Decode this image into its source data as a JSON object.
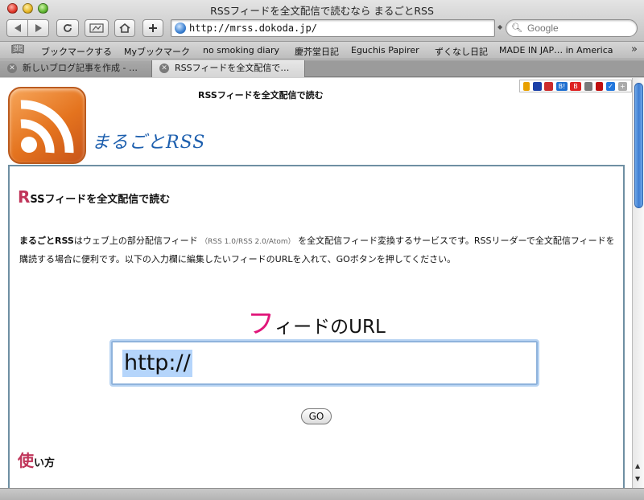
{
  "window": {
    "title": "RSSフィードを全文配信で読むなら まるごとRSS"
  },
  "toolbar": {
    "url": "http://mrss.dokoda.jp/",
    "search_placeholder": "Google"
  },
  "bookmarks": [
    "ブックマークする",
    "Myブックマーク",
    "no smoking diary",
    "慶芥堂日記",
    "Eguchis Papirer",
    "ずくなし日記",
    "MADE IN JAP… in America"
  ],
  "tabs": [
    "新しいブログ記事を作成 - …",
    "RSSフィードを全文配信で…"
  ],
  "page": {
    "tagline": "RSSフィードを全文配信で読む",
    "site_name": "まるごとRSS",
    "section_cap": "R",
    "section_rest": "SSフィードを全文配信で読む",
    "intro_bold": "まるごとRSS",
    "intro_a": "はウェブ上の部分配信フィード",
    "intro_small": "（RSS 1.0/RSS 2.0/Atom）",
    "intro_b": "を全文配信フィード変換するサービスです。RSSリーダーで全文配信フィードを購読する場合に便利です。以下の入力欄に編集したいフィードのURLを入れて、GOボタンを押してください。",
    "url_heading_cap": "フ",
    "url_heading_rest": "ィードのURL",
    "feed_url_value": "http://",
    "go_label": "GO",
    "usage_cap": "使",
    "usage_rest": "い方"
  },
  "social_icons": [
    "hatena-icon",
    "delicious-icon",
    "livedoor-clip-icon",
    "hatena-bookmark-icon",
    "buzzurl-icon",
    "clip-icon",
    "yahoo-icon",
    "check-icon",
    "plus-icon"
  ]
}
